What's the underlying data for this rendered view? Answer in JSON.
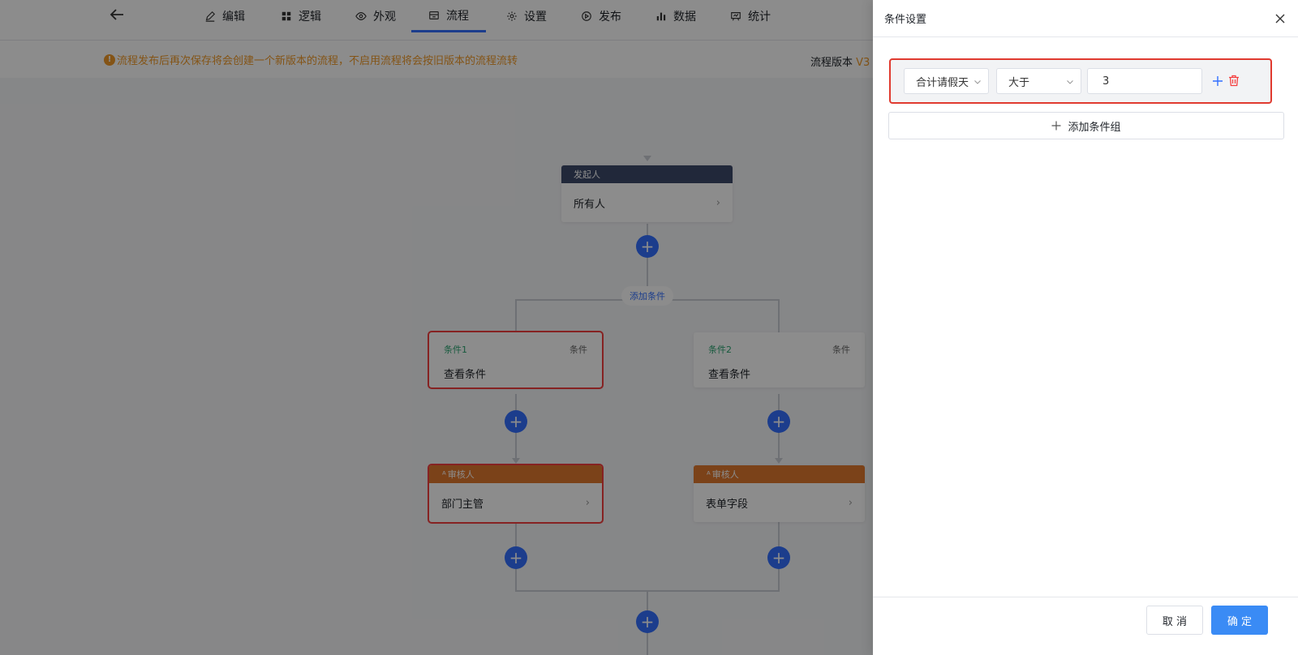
{
  "topbar": {
    "tabs": [
      {
        "label": "编辑",
        "icon": "edit-icon"
      },
      {
        "label": "逻辑",
        "icon": "grid-icon"
      },
      {
        "label": "外观",
        "icon": "eye-icon"
      },
      {
        "label": "流程",
        "icon": "flow-icon",
        "active": true
      },
      {
        "label": "设置",
        "icon": "gear-icon"
      },
      {
        "label": "发布",
        "icon": "play-icon"
      },
      {
        "label": "数据",
        "icon": "bar-chart-icon"
      },
      {
        "label": "统计",
        "icon": "stats-icon"
      }
    ]
  },
  "notice": {
    "text": "流程发布后再次保存将会创建一个新版本的流程，不启用流程将会按旧版本的流程流转",
    "version_label": "流程版本",
    "version_value": "V3"
  },
  "flow": {
    "initiator": {
      "header": "发起人",
      "body": "所有人"
    },
    "add_condition": "添加条件",
    "branches": [
      {
        "name": "条件1",
        "tag": "条件",
        "body": "查看条件"
      },
      {
        "name": "条件2",
        "tag": "条件",
        "body": "查看条件"
      }
    ],
    "approvers": [
      {
        "header": "审核人",
        "body": "部门主管"
      },
      {
        "header": "审核人",
        "body": "表单字段"
      }
    ]
  },
  "drawer": {
    "title": "条件设置",
    "condition": {
      "field": "合计请假天",
      "operator": "大于",
      "value": "3"
    },
    "add_group_label": "添加条件组",
    "cancel_label": "取 消",
    "ok_label": "确 定"
  },
  "colors": {
    "primary": "#3370ff",
    "warning": "#f09a28",
    "initiator_header": "#3d4a6b",
    "approver_header": "#e0782e",
    "condition_name": "#2ba471",
    "danger": "#f53f3f"
  }
}
